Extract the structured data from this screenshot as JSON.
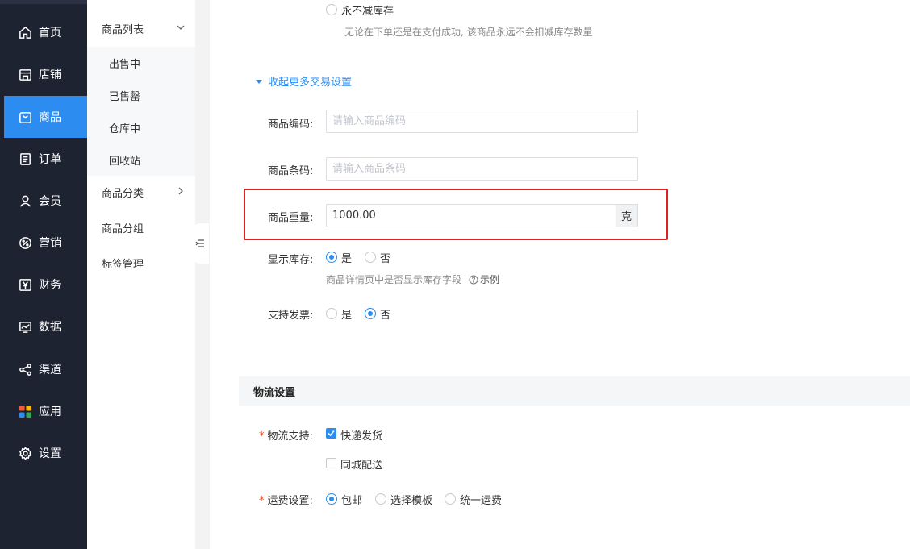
{
  "nav": {
    "items": [
      {
        "label": "首页",
        "icon": "home-icon"
      },
      {
        "label": "店铺",
        "icon": "store-icon"
      },
      {
        "label": "商品",
        "icon": "bag-icon",
        "active": true
      },
      {
        "label": "订单",
        "icon": "order-icon"
      },
      {
        "label": "会员",
        "icon": "user-icon"
      },
      {
        "label": "营销",
        "icon": "marketing-icon"
      },
      {
        "label": "财务",
        "icon": "finance-icon"
      },
      {
        "label": "数据",
        "icon": "data-icon"
      },
      {
        "label": "渠道",
        "icon": "channel-icon"
      },
      {
        "label": "应用",
        "icon": "apps-icon"
      },
      {
        "label": "设置",
        "icon": "gear-icon"
      }
    ]
  },
  "submenu": {
    "group_list": "商品列表",
    "items": [
      "出售中",
      "已售罄",
      "仓库中",
      "回收站"
    ],
    "group_category": "商品分类",
    "group_grouping": "商品分组",
    "group_tags": "标签管理"
  },
  "form": {
    "stock_option_never": "永不减库存",
    "stock_option_never_hint": "无论在下单还是在支付成功, 该商品永远不会扣减库存数量",
    "toggle_more": "收起更多交易设置",
    "code_label": "商品编码:",
    "code_placeholder": "请输入商品编码",
    "barcode_label": "商品条码:",
    "barcode_placeholder": "请输入商品条码",
    "weight_label": "商品重量:",
    "weight_value": "1000.00",
    "weight_unit": "克",
    "show_stock_label": "显示库存:",
    "show_stock_yes": "是",
    "show_stock_no": "否",
    "show_stock_hint": "商品详情页中是否显示库存字段",
    "show_stock_example": "示例",
    "invoice_label": "支持发票:",
    "invoice_yes": "是",
    "invoice_no": "否"
  },
  "logistics": {
    "section_title": "物流设置",
    "support_label": "物流支持:",
    "express": "快递发货",
    "local": "同城配送",
    "freight_label": "运费设置:",
    "free_shipping": "包邮",
    "select_template": "选择模板",
    "flat_rate": "统一运费"
  },
  "colors": {
    "accent": "#2d8cf0",
    "nav_bg": "#1e2332",
    "highlight_border": "#e0201e",
    "required": "#ed4014"
  }
}
